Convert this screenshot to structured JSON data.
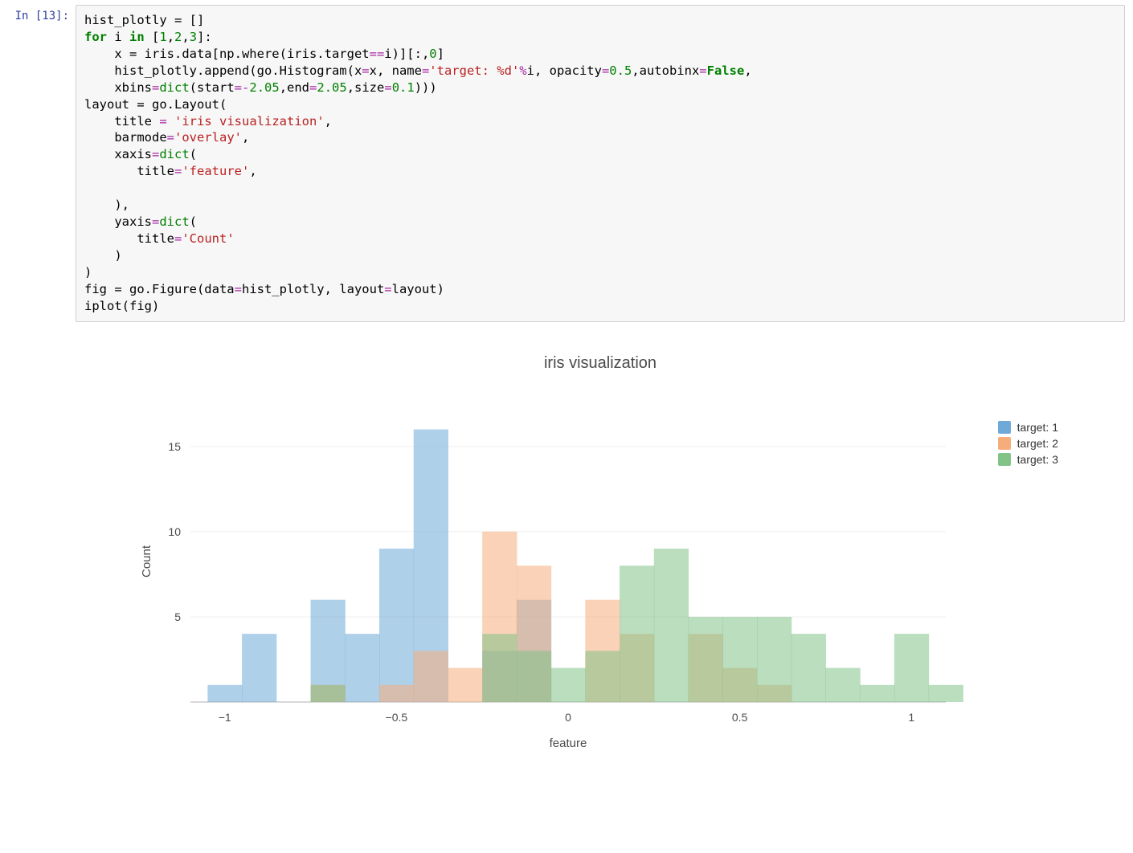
{
  "prompt": {
    "label": "In [13]:"
  },
  "code": {
    "l01a": "hist_plotly = []",
    "l02a": "for",
    "l02b": " i ",
    "l02c": "in",
    "l02d": " [",
    "l02e": "1",
    "l02f": ",",
    "l02g": "2",
    "l02h": ",",
    "l02i": "3",
    "l02j": "]:",
    "l03a": "    x = iris.data[np.where(iris.target",
    "l03b": "==",
    "l03c": "i)][:,",
    "l03d": "0",
    "l03e": "]",
    "l04a": "    hist_plotly.append(go.Histogram(x",
    "l04b": "=",
    "l04c": "x, name",
    "l04d": "=",
    "l04e": "'target: %d'",
    "l04f": "%",
    "l04g": "i, opacity",
    "l04h": "=",
    "l04i": "0.5",
    "l04j": ",autobinx",
    "l04k": "=",
    "l04l": "False",
    "l04m": ",",
    "l05a": "    xbins",
    "l05b": "=",
    "l05c": "dict",
    "l05d": "(start",
    "l05e": "=",
    "l05f": "-",
    "l05g": "2.05",
    "l05h": ",end",
    "l05i": "=",
    "l05j": "2.05",
    "l05k": ",size",
    "l05l": "=",
    "l05m": "0.1",
    "l05n": ")))",
    "l06a": "layout = go.Layout(",
    "l07a": "    title ",
    "l07b": "=",
    "l07c": " ",
    "l07d": "'iris visualization'",
    "l07e": ",",
    "l08a": "    barmode",
    "l08b": "=",
    "l08c": "'overlay'",
    "l08d": ",",
    "l09a": "    xaxis",
    "l09b": "=",
    "l09c": "dict",
    "l09d": "(",
    "l10a": "       title",
    "l10b": "=",
    "l10c": "'feature'",
    "l10d": ",",
    "l11a": "",
    "l12a": "    ),",
    "l13a": "    yaxis",
    "l13b": "=",
    "l13c": "dict",
    "l13d": "(",
    "l14a": "       title",
    "l14b": "=",
    "l14c": "'Count'",
    "l15a": "    )",
    "l16a": ")",
    "l17a": "fig = go.Figure(data",
    "l17b": "=",
    "l17c": "hist_plotly, layout",
    "l17d": "=",
    "l17e": "layout)",
    "l18a": "iplot(fig)"
  },
  "chart_data": {
    "type": "bar",
    "title": "iris visualization",
    "xlabel": "feature",
    "ylabel": "Count",
    "xlim": [
      -1.1,
      1.1
    ],
    "ylim": [
      0,
      16.5
    ],
    "yticks": [
      5,
      10,
      15
    ],
    "xticks": [
      -1,
      -0.5,
      0,
      0.5,
      1
    ],
    "bin_width": 0.1,
    "bin_start": -1.05,
    "legend_position": "right",
    "colors": {
      "target: 1": "#6ea9d7",
      "target: 2": "#f6ad7b",
      "target: 3": "#82c388"
    },
    "series": [
      {
        "name": "target: 1",
        "values": [
          1,
          4,
          0,
          6,
          4,
          9,
          16,
          0,
          3,
          6,
          0,
          0,
          0,
          0,
          0,
          0,
          0,
          0,
          0,
          0,
          0
        ]
      },
      {
        "name": "target: 2",
        "values": [
          0,
          0,
          0,
          1,
          0,
          1,
          3,
          2,
          10,
          8,
          0,
          6,
          4,
          0,
          4,
          2,
          1,
          0,
          0,
          0,
          0
        ]
      },
      {
        "name": "target: 3",
        "values": [
          0,
          0,
          0,
          1,
          0,
          0,
          0,
          0,
          4,
          3,
          2,
          3,
          8,
          9,
          5,
          5,
          5,
          4,
          2,
          1,
          4,
          1
        ]
      }
    ]
  },
  "legend": {
    "items": [
      {
        "label": "target: 1",
        "color": "#6ea9d7"
      },
      {
        "label": "target: 2",
        "color": "#f6ad7b"
      },
      {
        "label": "target: 3",
        "color": "#82c388"
      }
    ]
  }
}
